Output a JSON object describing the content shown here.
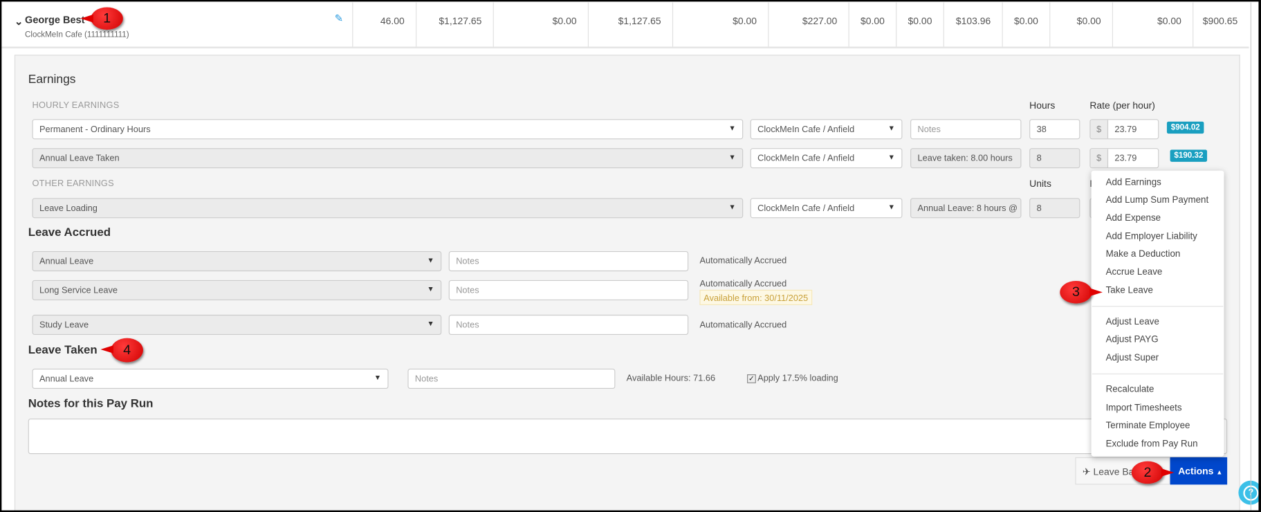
{
  "employee": {
    "name": "George Best",
    "subtitle": "ClockMeIn Cafe (1111111111)",
    "values": [
      "46.00",
      "$1,127.65",
      "$0.00",
      "$1,127.65",
      "$0.00",
      "$227.00",
      "$0.00",
      "$0.00",
      "$103.96",
      "$0.00",
      "$0.00",
      "$0.00",
      "$900.65"
    ]
  },
  "earnings": {
    "title": "Earnings",
    "hourly_label": "HOURLY EARNINGS",
    "other_label": "OTHER EARNINGS",
    "hours_header": "Hours",
    "rate_header": "Rate (per hour)",
    "units_header": "Units",
    "rate_header_partial": "R",
    "currency": "$",
    "rows": [
      {
        "type": "Permanent - Ordinary Hours",
        "location": "ClockMeIn Cafe / Anfield",
        "notes_placeholder": "Notes",
        "notes": "",
        "hours": "38",
        "rate": "23.79",
        "total": "$904.02"
      },
      {
        "type": "Annual Leave Taken",
        "location": "ClockMeIn Cafe / Anfield",
        "notes": "Leave taken: 8.00 hours",
        "hours": "8",
        "rate": "23.79",
        "total": "$190.32"
      },
      {
        "type": "Leave Loading",
        "location": "ClockMeIn Cafe / Anfield",
        "notes": "Annual Leave: 8 hours @",
        "units": "8"
      }
    ]
  },
  "leave_accrued": {
    "title": "Leave Accrued",
    "notes_placeholder": "Notes",
    "rows": [
      {
        "type": "Annual Leave",
        "status": "Automatically Accrued"
      },
      {
        "type": "Long Service Leave",
        "status": "Automatically Accrued",
        "available": "Available from: 30/11/2025"
      },
      {
        "type": "Study Leave",
        "status": "Automatically Accrued"
      }
    ]
  },
  "leave_taken": {
    "title": "Leave Taken",
    "type": "Annual Leave",
    "notes_placeholder": "Notes",
    "available": "Available Hours: 71.66",
    "loading_label": "Apply 17.5% loading",
    "loading_checked": true
  },
  "notes_section": {
    "title": "Notes for this Pay Run",
    "value": ""
  },
  "buttons": {
    "leave_balances": "Leave Bal",
    "actions": "Actions"
  },
  "actions_menu": {
    "groups": [
      [
        "Add Earnings",
        "Add Lump Sum Payment",
        "Add Expense",
        "Add Employer Liability",
        "Make a Deduction",
        "Accrue Leave",
        "Take Leave"
      ],
      [
        "Adjust Leave",
        "Adjust PAYG",
        "Adjust Super"
      ],
      [
        "Recalculate",
        "Import Timesheets",
        "Terminate Employee",
        "Exclude from Pay Run"
      ]
    ]
  },
  "annotations": [
    "1",
    "2",
    "3",
    "4"
  ],
  "colors": {
    "actions_button": "#0047cc",
    "badge": "#1a9fc0",
    "annotation": "#e00000",
    "help": "#3cc0e8"
  }
}
